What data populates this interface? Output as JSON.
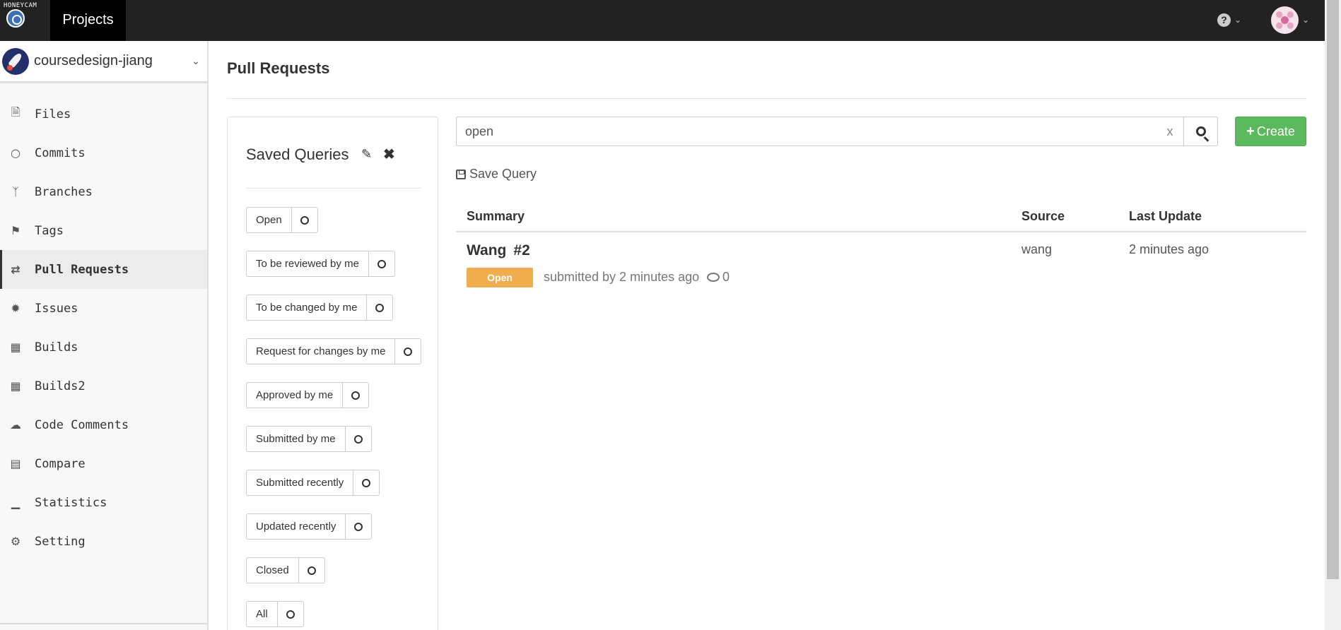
{
  "topbar": {
    "logo_text": "HONEYCAM",
    "projects_label": "Projects",
    "help_icon": "question-circle-icon",
    "avatar_icon": "user-avatar"
  },
  "sidebar": {
    "project_name": "coursedesign-jiang",
    "items": [
      {
        "label": "Files",
        "icon": "file-icon"
      },
      {
        "label": "Commits",
        "icon": "commit-icon"
      },
      {
        "label": "Branches",
        "icon": "branch-icon"
      },
      {
        "label": "Tags",
        "icon": "tag-icon"
      },
      {
        "label": "Pull Requests",
        "icon": "pull-request-icon",
        "active": true
      },
      {
        "label": "Issues",
        "icon": "bug-icon"
      },
      {
        "label": "Builds",
        "icon": "cubes-icon"
      },
      {
        "label": "Builds2",
        "icon": "cubes-icon"
      },
      {
        "label": "Code Comments",
        "icon": "comments-icon"
      },
      {
        "label": "Compare",
        "icon": "compare-icon"
      },
      {
        "label": "Statistics",
        "icon": "chart-icon"
      },
      {
        "label": "Setting",
        "icon": "gear-icon"
      }
    ]
  },
  "main": {
    "title": "Pull Requests",
    "saved_queries": {
      "title": "Saved Queries",
      "items": [
        "Open",
        "To be reviewed by me",
        "To be changed by me",
        "Request for changes by me",
        "Approved by me",
        "Submitted by me",
        "Submitted recently",
        "Updated recently",
        "Closed",
        "All"
      ]
    },
    "search": {
      "value": "open",
      "clear_label": "x"
    },
    "create_label": "Create",
    "save_query_label": "Save Query",
    "table": {
      "headers": [
        "Summary",
        "Source",
        "Last Update"
      ],
      "rows": [
        {
          "title": "Wang",
          "number": "#2",
          "status": "Open",
          "submitted": "submitted by 2 minutes ago",
          "comments": "0",
          "source": "wang",
          "last_update": "2 minutes ago"
        }
      ]
    }
  },
  "colors": {
    "topbar": "#222222",
    "create_button": "#5cb85c",
    "open_badge": "#f0ad4e"
  }
}
